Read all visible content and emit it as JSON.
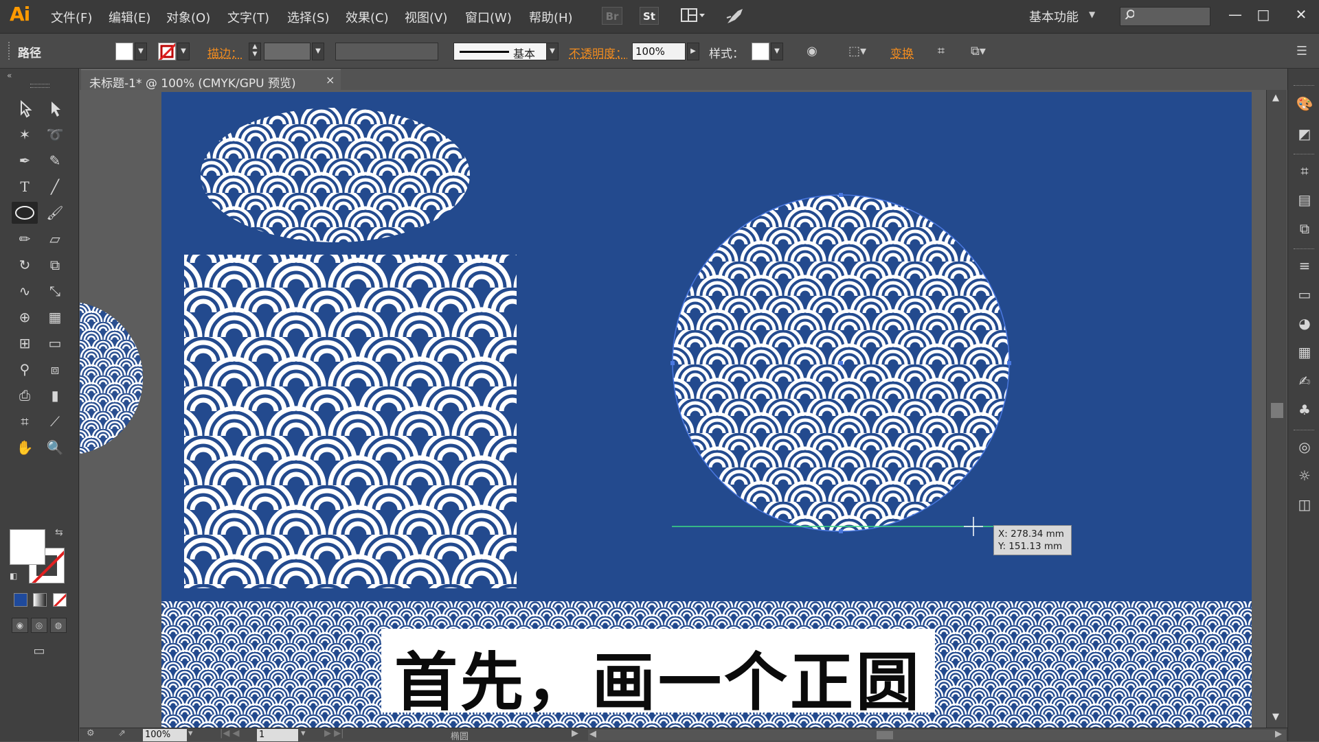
{
  "app": {
    "logo": "Ai"
  },
  "menu": [
    "文件(F)",
    "编辑(E)",
    "对象(O)",
    "文字(T)",
    "选择(S)",
    "效果(C)",
    "视图(V)",
    "窗口(W)",
    "帮助(H)"
  ],
  "menubar_buttons": {
    "bridge": "Br",
    "stock": "St"
  },
  "workspace": {
    "label": "基本功能"
  },
  "window_controls": {
    "minimize": "—",
    "maximize": "□",
    "close": "✕"
  },
  "control_bar": {
    "selection_type": "路径",
    "stroke_label": "描边：",
    "stroke_profile": "基本",
    "opacity_label": "不透明度：",
    "opacity_value": "100%",
    "style_label": "样式：",
    "transform_label": "变换"
  },
  "document": {
    "tab_title": "未标题-1* @ 100% (CMYK/GPU 预览)",
    "tab_close": "×"
  },
  "cursor_readout": {
    "x": "X: 278.34 mm",
    "y": "Y: 151.13 mm"
  },
  "status_bar": {
    "zoom": "100%",
    "artboard": "1",
    "tool_name": "椭圆"
  },
  "subtitle": "首先，画一个正圆",
  "colors": {
    "artboard": "#234a8e",
    "pattern": "#ffffff",
    "accent": "#f28c1f",
    "selection": "#4a78e0",
    "smart_guide": "#3ddc84"
  },
  "icons": {
    "tools": [
      "selection-tool-icon",
      "direct-selection-tool-icon",
      "magic-wand-icon",
      "lasso-icon",
      "pen-tool-icon",
      "curvature-tool-icon",
      "type-tool-icon",
      "line-tool-icon",
      "ellipse-tool-icon",
      "paintbrush-icon",
      "pencil-icon",
      "eraser-icon",
      "rotate-icon",
      "scale-icon",
      "warp-icon",
      "free-transform-icon",
      "shape-builder-icon",
      "perspective-grid-icon",
      "mesh-icon",
      "gradient-icon",
      "eyedropper-icon",
      "blend-icon",
      "symbol-sprayer-icon",
      "column-graph-icon",
      "artboard-icon",
      "slice-icon",
      "hand-icon",
      "zoom-icon"
    ],
    "dock": [
      "color-panel-icon",
      "color-guide-icon",
      "transform-panel-icon",
      "align-icon",
      "pathfinder-icon",
      "stroke-icon",
      "gradient-panel-icon",
      "transparency-icon",
      "swatches-icon",
      "brushes-icon",
      "symbols-icon",
      "graphic-styles-icon",
      "appearance-icon",
      "layers-icon"
    ]
  }
}
